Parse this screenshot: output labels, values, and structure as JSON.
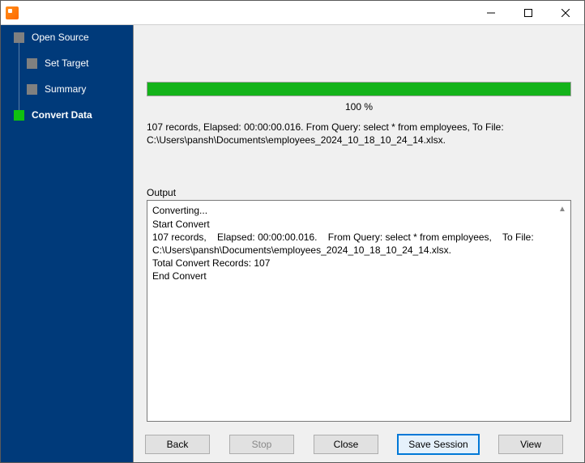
{
  "titlebar": {
    "title": ""
  },
  "sidebar": {
    "items": [
      {
        "label": "Open Source",
        "indent": 0,
        "active": false,
        "bold": false
      },
      {
        "label": "Set Target",
        "indent": 1,
        "active": false,
        "bold": false
      },
      {
        "label": "Summary",
        "indent": 1,
        "active": false,
        "bold": false
      },
      {
        "label": "Convert Data",
        "indent": 0,
        "active": true,
        "bold": true
      }
    ]
  },
  "progress": {
    "percent_label": "100 %",
    "percent_value": 100
  },
  "summary": {
    "text": "107 records,    Elapsed: 00:00:00.016.    From Query: select * from employees,    To File: C:\\Users\\pansh\\Documents\\employees_2024_10_18_10_24_14.xlsx."
  },
  "output": {
    "label": "Output",
    "log": "Converting...\nStart Convert\n107 records,    Elapsed: 00:00:00.016.    From Query: select * from employees,    To File: C:\\Users\\pansh\\Documents\\employees_2024_10_18_10_24_14.xlsx.\nTotal Convert Records: 107\nEnd Convert"
  },
  "buttons": {
    "back": "Back",
    "stop": "Stop",
    "close": "Close",
    "save_session": "Save Session",
    "view": "View"
  }
}
